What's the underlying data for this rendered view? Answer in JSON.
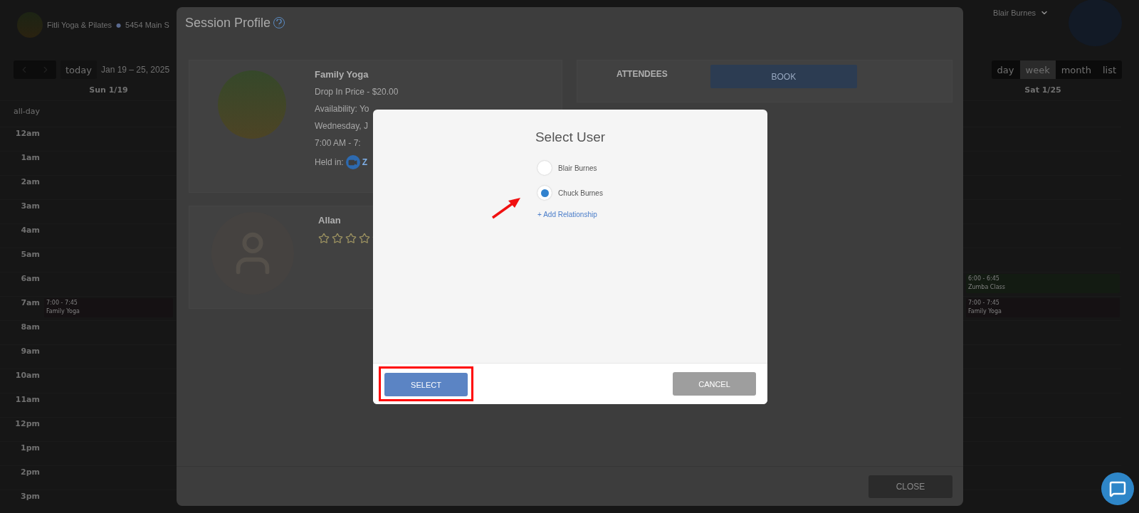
{
  "header": {
    "studio": "Fitli Yoga & Pilates",
    "separator": "●",
    "address": "5454 Main S",
    "user": "Blair Burnes"
  },
  "toolbar": {
    "today": "today",
    "range": "Jan 19 – 25, 2025",
    "views": [
      {
        "label": "day",
        "selected": false
      },
      {
        "label": "week",
        "selected": true
      },
      {
        "label": "month",
        "selected": false
      },
      {
        "label": "list",
        "selected": false
      }
    ]
  },
  "calendar": {
    "days": [
      "Sun 1/19",
      "Sat 1/25"
    ],
    "all_day": "all-day",
    "rows": [
      {
        "time": "12am",
        "cells": [
          null,
          null
        ]
      },
      {
        "time": "1am",
        "cells": [
          null,
          null
        ]
      },
      {
        "time": "2am",
        "cells": [
          null,
          null
        ]
      },
      {
        "time": "3am",
        "cells": [
          null,
          null
        ]
      },
      {
        "time": "4am",
        "cells": [
          null,
          null
        ]
      },
      {
        "time": "5am",
        "cells": [
          null,
          null
        ]
      },
      {
        "time": "6am",
        "cells": [
          null,
          {
            "time": "6:00 - 6:45",
            "title": "Zumba Class",
            "color": "#131b12"
          }
        ]
      },
      {
        "time": "7am",
        "cells": [
          {
            "time": "7:00 - 7:45",
            "title": "Family Yoga",
            "color": "#151113"
          },
          {
            "time": "7:00 - 7:45",
            "title": "Family Yoga",
            "color": "#151113"
          }
        ]
      },
      {
        "time": "8am",
        "cells": [
          null,
          null
        ]
      },
      {
        "time": "9am",
        "cells": [
          null,
          null
        ]
      },
      {
        "time": "10am",
        "cells": [
          null,
          null
        ]
      },
      {
        "time": "11am",
        "cells": [
          null,
          null
        ]
      },
      {
        "time": "12pm",
        "cells": [
          null,
          null
        ]
      },
      {
        "time": "1pm",
        "cells": [
          null,
          null
        ]
      },
      {
        "time": "2pm",
        "cells": [
          null,
          null
        ]
      },
      {
        "time": "3pm",
        "cells": [
          null,
          null
        ]
      }
    ]
  },
  "session_profile": {
    "title": "Session Profile",
    "class": {
      "name": "Family Yoga",
      "lines": [
        "Drop In Price - $20.00",
        "Availability: Yo",
        "Wednesday, J",
        "7:00 AM - 7:"
      ],
      "held_in": "Held in:",
      "held_in_value": "Z"
    },
    "instructor": {
      "name": "Allan",
      "stars": 0
    },
    "attendees": {
      "label": "ATTENDEES",
      "book": "BOOK"
    },
    "close": "CLOSE"
  },
  "select_user": {
    "title": "Select User",
    "options": [
      {
        "label": "Blair Burnes",
        "selected": false
      },
      {
        "label": "Chuck Burnes",
        "selected": true
      }
    ],
    "add_link": "+ Add Relationship",
    "select": "SELECT",
    "cancel": "CANCEL",
    "highlighted": true
  }
}
